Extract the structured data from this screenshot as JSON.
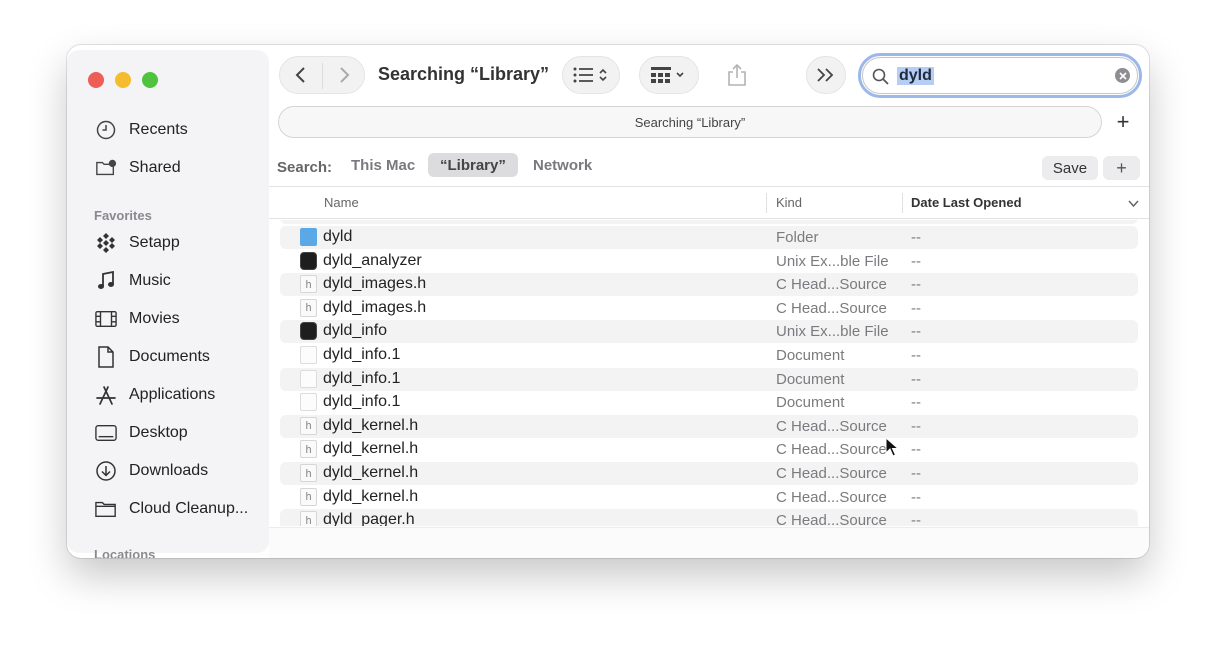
{
  "window": {
    "title": "Searching “Library”"
  },
  "sidebar": {
    "top_items": [
      {
        "label": "Recents",
        "icon": "clock-icon"
      },
      {
        "label": "Shared",
        "icon": "shared-folder-icon"
      }
    ],
    "favorites_heading": "Favorites",
    "favorites": [
      {
        "label": "Setapp",
        "icon": "setapp-icon"
      },
      {
        "label": "Music",
        "icon": "music-note-icon"
      },
      {
        "label": "Movies",
        "icon": "film-icon"
      },
      {
        "label": "Documents",
        "icon": "document-icon"
      },
      {
        "label": "Applications",
        "icon": "applications-icon"
      },
      {
        "label": "Desktop",
        "icon": "desktop-icon"
      },
      {
        "label": "Downloads",
        "icon": "download-icon"
      },
      {
        "label": "Cloud Cleanup...",
        "icon": "folder-icon"
      }
    ],
    "locations_heading": "Locations"
  },
  "search": {
    "query": "dyld"
  },
  "scope": {
    "label": "Searching “Library”"
  },
  "search_bar": {
    "label": "Search:",
    "options": [
      "This Mac",
      "“Library”",
      "Network"
    ],
    "active": "“Library”",
    "save_label": "Save",
    "add_label": "+"
  },
  "columns": {
    "name": "Name",
    "kind": "Kind",
    "date": "Date Last Opened"
  },
  "rows": [
    {
      "name": "dyld",
      "kind": "Folder",
      "date": "--",
      "icon": "folder"
    },
    {
      "name": "dyld_analyzer",
      "kind": "Unix Ex...ble File",
      "date": "--",
      "icon": "exec"
    },
    {
      "name": "dyld_images.h",
      "kind": "C Head...Source",
      "date": "--",
      "icon": "h"
    },
    {
      "name": "dyld_images.h",
      "kind": "C Head...Source",
      "date": "--",
      "icon": "h"
    },
    {
      "name": "dyld_info",
      "kind": "Unix Ex...ble File",
      "date": "--",
      "icon": "exec"
    },
    {
      "name": "dyld_info.1",
      "kind": "Document",
      "date": "--",
      "icon": "doc"
    },
    {
      "name": "dyld_info.1",
      "kind": "Document",
      "date": "--",
      "icon": "doc"
    },
    {
      "name": "dyld_info.1",
      "kind": "Document",
      "date": "--",
      "icon": "doc"
    },
    {
      "name": "dyld_kernel.h",
      "kind": "C Head...Source",
      "date": "--",
      "icon": "h"
    },
    {
      "name": "dyld_kernel.h",
      "kind": "C Head...Source",
      "date": "--",
      "icon": "h"
    },
    {
      "name": "dyld_kernel.h",
      "kind": "C Head...Source",
      "date": "--",
      "icon": "h"
    },
    {
      "name": "dyld_kernel.h",
      "kind": "C Head...Source",
      "date": "--",
      "icon": "h"
    },
    {
      "name": "dyld_pager.h",
      "kind": "C Head...Source",
      "date": "--",
      "icon": "h"
    }
  ],
  "colors": {
    "close": "#ee5d56",
    "minimize": "#f6bc2f",
    "zoom": "#4fc33d",
    "folder_blue": "#5aa8e6",
    "search_focus": "#9cb8ea",
    "selection": "#b6cdf4"
  }
}
